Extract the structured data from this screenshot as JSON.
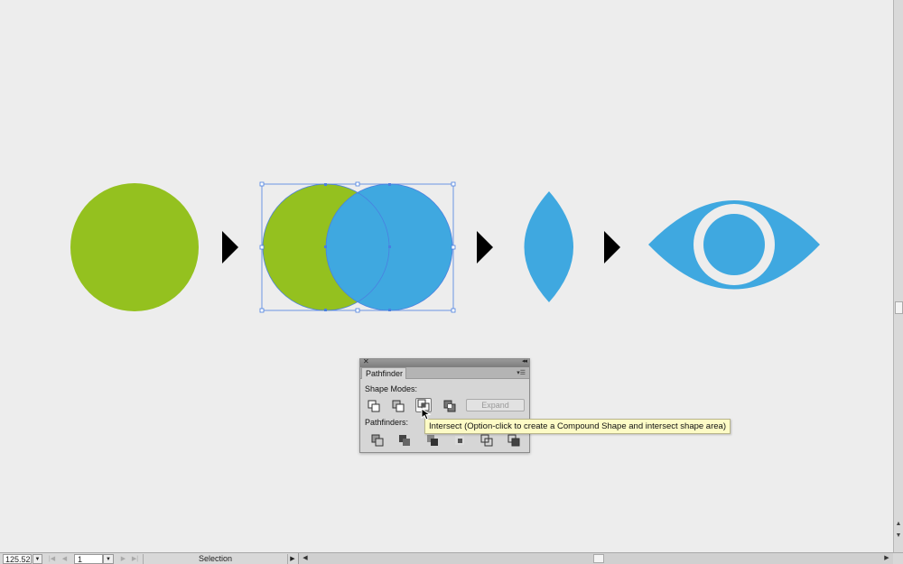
{
  "colors": {
    "green": "#94c11f",
    "blue": "#3fa8e0",
    "arrow": "#000000",
    "selection": "#4a7fe0",
    "background": "#ededed"
  },
  "artwork": {
    "shapes": [
      "green-circle",
      "overlapping-circles",
      "lens-shape",
      "eye-icon"
    ]
  },
  "pathfinder": {
    "tab_label": "Pathfinder",
    "shape_modes_label": "Shape Modes:",
    "pathfinders_label": "Pathfinders:",
    "expand_label": "Expand",
    "shape_mode_icons": [
      "unite-icon",
      "minus-front-icon",
      "intersect-icon",
      "exclude-icon"
    ],
    "pathfinder_icons": [
      "divide-icon",
      "trim-icon",
      "merge-icon",
      "crop-icon",
      "outline-icon",
      "minus-back-icon"
    ]
  },
  "tooltip": {
    "text": "Intersect (Option-click to create a Compound Shape and intersect shape area)"
  },
  "statusbar": {
    "zoom": "125.52",
    "page": "1",
    "tool": "Selection"
  }
}
